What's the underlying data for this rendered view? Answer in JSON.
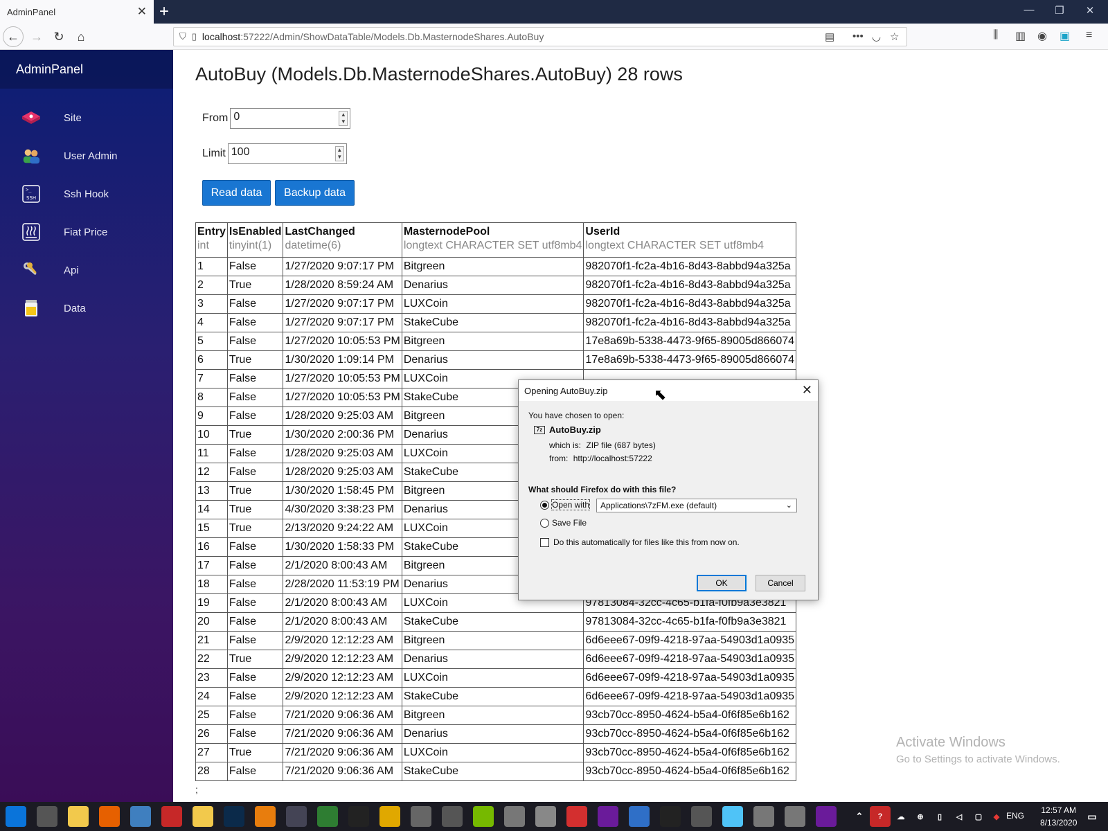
{
  "browser": {
    "tab_title": "AdminPanel",
    "tab_close": "✕",
    "new_tab": "+",
    "url_host": "localhost",
    "url_path": ":57222/Admin/ShowDataTable/Models.Db.MasternodeShares.AutoBuy",
    "window_controls": {
      "minimize": "—",
      "maximize": "❐",
      "close": "✕"
    },
    "icons": [
      "back-icon",
      "forward-icon",
      "reload-icon",
      "home-icon",
      "shield-icon",
      "page-icon",
      "reader-view-icon",
      "more-icon",
      "pocket-icon",
      "bookmark-star-icon",
      "library-icon",
      "sidebar-icon",
      "account-icon",
      "save-icon",
      "menu-icon"
    ]
  },
  "sidebar": {
    "brand": "AdminPanel",
    "items": [
      {
        "label": "Site",
        "icon": "site-icon"
      },
      {
        "label": "User Admin",
        "icon": "users-icon"
      },
      {
        "label": "Ssh Hook",
        "icon": "ssh-icon"
      },
      {
        "label": "Fiat Price",
        "icon": "heat-icon"
      },
      {
        "label": "Api",
        "icon": "keys-icon"
      },
      {
        "label": "Data",
        "icon": "jar-icon"
      }
    ]
  },
  "main": {
    "title": "AutoBuy (Models.Db.MasternodeShares.AutoBuy) 28 rows",
    "from_label": "From",
    "from_value": "0",
    "limit_label": "Limit",
    "limit_value": "100",
    "read_button": "Read data",
    "backup_button": "Backup data",
    "trailing_text": ";"
  },
  "table": {
    "columns": [
      {
        "name": "Entry",
        "type": "int"
      },
      {
        "name": "IsEnabled",
        "type": "tinyint(1)"
      },
      {
        "name": "LastChanged",
        "type": "datetime(6)"
      },
      {
        "name": "MasternodePool",
        "type": "longtext CHARACTER SET utf8mb4"
      },
      {
        "name": "UserId",
        "type": "longtext CHARACTER SET utf8mb4"
      }
    ],
    "rows": [
      [
        "1",
        "False",
        "1/27/2020 9:07:17 PM",
        "Bitgreen",
        "982070f1-fc2a-4b16-8d43-8abbd94a325a"
      ],
      [
        "2",
        "True",
        "1/28/2020 8:59:24 AM",
        "Denarius",
        "982070f1-fc2a-4b16-8d43-8abbd94a325a"
      ],
      [
        "3",
        "False",
        "1/27/2020 9:07:17 PM",
        "LUXCoin",
        "982070f1-fc2a-4b16-8d43-8abbd94a325a"
      ],
      [
        "4",
        "False",
        "1/27/2020 9:07:17 PM",
        "StakeCube",
        "982070f1-fc2a-4b16-8d43-8abbd94a325a"
      ],
      [
        "5",
        "False",
        "1/27/2020 10:05:53 PM",
        "Bitgreen",
        "17e8a69b-5338-4473-9f65-89005d866074"
      ],
      [
        "6",
        "True",
        "1/30/2020 1:09:14 PM",
        "Denarius",
        "17e8a69b-5338-4473-9f65-89005d866074"
      ],
      [
        "7",
        "False",
        "1/27/2020 10:05:53 PM",
        "LUXCoin",
        ""
      ],
      [
        "8",
        "False",
        "1/27/2020 10:05:53 PM",
        "StakeCube",
        ""
      ],
      [
        "9",
        "False",
        "1/28/2020 9:25:03 AM",
        "Bitgreen",
        ""
      ],
      [
        "10",
        "True",
        "1/30/2020 2:00:36 PM",
        "Denarius",
        ""
      ],
      [
        "11",
        "False",
        "1/28/2020 9:25:03 AM",
        "LUXCoin",
        ""
      ],
      [
        "12",
        "False",
        "1/28/2020 9:25:03 AM",
        "StakeCube",
        ""
      ],
      [
        "13",
        "True",
        "1/30/2020 1:58:45 PM",
        "Bitgreen",
        ""
      ],
      [
        "14",
        "True",
        "4/30/2020 3:38:23 PM",
        "Denarius",
        ""
      ],
      [
        "15",
        "True",
        "2/13/2020 9:24:22 AM",
        "LUXCoin",
        ""
      ],
      [
        "16",
        "False",
        "1/30/2020 1:58:33 PM",
        "StakeCube",
        ""
      ],
      [
        "17",
        "False",
        "2/1/2020 8:00:43 AM",
        "Bitgreen",
        ""
      ],
      [
        "18",
        "False",
        "2/28/2020 11:53:19 PM",
        "Denarius",
        ""
      ],
      [
        "19",
        "False",
        "2/1/2020 8:00:43 AM",
        "LUXCoin",
        "97813084-32cc-4c65-b1fa-f0fb9a3e3821"
      ],
      [
        "20",
        "False",
        "2/1/2020 8:00:43 AM",
        "StakeCube",
        "97813084-32cc-4c65-b1fa-f0fb9a3e3821"
      ],
      [
        "21",
        "False",
        "2/9/2020 12:12:23 AM",
        "Bitgreen",
        "6d6eee67-09f9-4218-97aa-54903d1a0935"
      ],
      [
        "22",
        "True",
        "2/9/2020 12:12:23 AM",
        "Denarius",
        "6d6eee67-09f9-4218-97aa-54903d1a0935"
      ],
      [
        "23",
        "False",
        "2/9/2020 12:12:23 AM",
        "LUXCoin",
        "6d6eee67-09f9-4218-97aa-54903d1a0935"
      ],
      [
        "24",
        "False",
        "2/9/2020 12:12:23 AM",
        "StakeCube",
        "6d6eee67-09f9-4218-97aa-54903d1a0935"
      ],
      [
        "25",
        "False",
        "7/21/2020 9:06:36 AM",
        "Bitgreen",
        "93cb70cc-8950-4624-b5a4-0f6f85e6b162"
      ],
      [
        "26",
        "False",
        "7/21/2020 9:06:36 AM",
        "Denarius",
        "93cb70cc-8950-4624-b5a4-0f6f85e6b162"
      ],
      [
        "27",
        "True",
        "7/21/2020 9:06:36 AM",
        "LUXCoin",
        "93cb70cc-8950-4624-b5a4-0f6f85e6b162"
      ],
      [
        "28",
        "False",
        "7/21/2020 9:06:36 AM",
        "StakeCube",
        "93cb70cc-8950-4624-b5a4-0f6f85e6b162"
      ]
    ]
  },
  "dialog": {
    "title": "Opening AutoBuy.zip",
    "close": "✕",
    "chosen_text": "You have chosen to open:",
    "file_icon_text": "7z",
    "filename": "AutoBuy.zip",
    "which_is_label": "which is:",
    "which_is_value": "ZIP file (687 bytes)",
    "from_label": "from:",
    "from_value": "http://localhost:57222",
    "question": "What should Firefox do with this file?",
    "open_with_label": "Open with",
    "open_with_value": "Applications\\7zFM.exe (default)",
    "open_with_selected": true,
    "save_file_label": "Save File",
    "auto_label": "Do this automatically for files like this from now on.",
    "auto_checked": false,
    "ok": "OK",
    "cancel": "Cancel"
  },
  "watermark": {
    "line1": "Activate Windows",
    "line2": "Go to Settings to activate Windows."
  },
  "taskbar": {
    "language": "ENG",
    "time": "12:57 AM",
    "date": "8/13/2020",
    "apps": [
      "windows-start-icon",
      "task-view-icon",
      "file-explorer-icon",
      "firefox-icon",
      "app-icon",
      "save-app-icon",
      "folder-icon",
      "photoshop-icon",
      "blender-icon",
      "app-icon",
      "spreadsheet-icon",
      "terminal-icon",
      "app-icon",
      "tools-icon",
      "app-icon",
      "app-icon",
      "calendar-icon",
      "app-icon",
      "opera-icon",
      "visual-studio-icon",
      "app-icon",
      "rider-icon",
      "app-icon",
      "app-icon",
      "app-icon",
      "app-icon",
      "visual-studio-icon"
    ],
    "colors": {
      "accent": "#1976d2",
      "taskbar": "#1b1b23"
    }
  }
}
